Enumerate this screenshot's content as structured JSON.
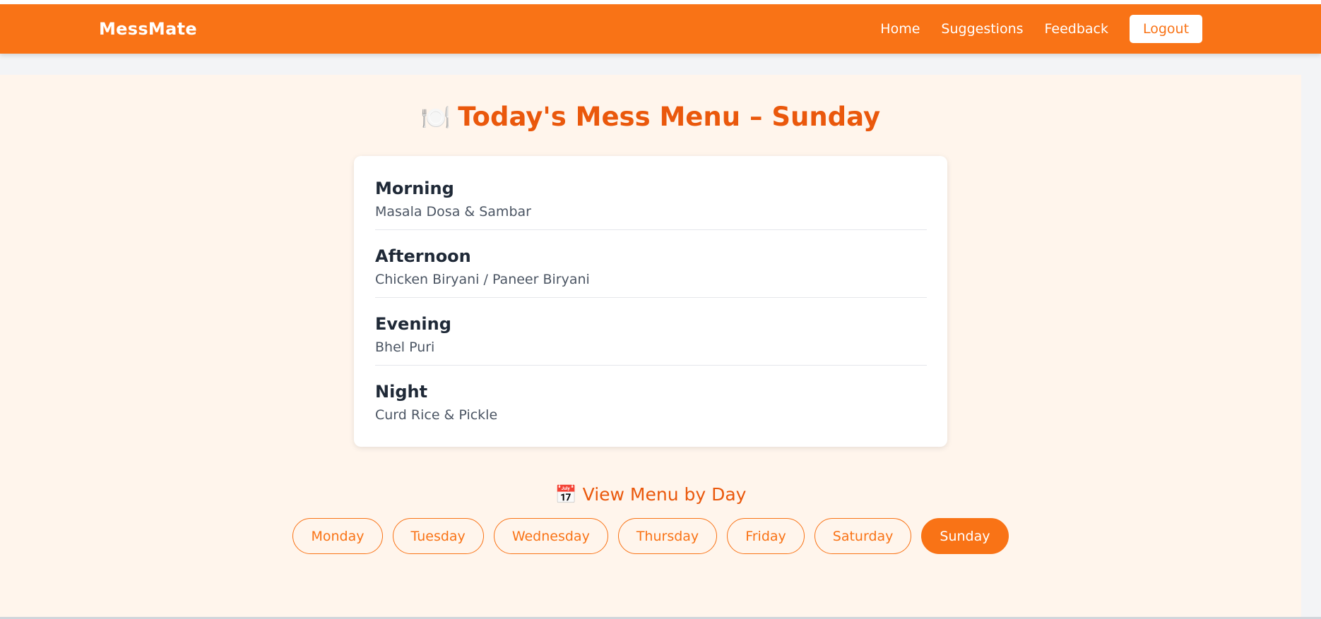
{
  "navbar": {
    "brand": "MessMate",
    "links": [
      {
        "label": "Home"
      },
      {
        "label": "Suggestions"
      },
      {
        "label": "Feedback"
      }
    ],
    "logout_label": "Logout"
  },
  "page": {
    "title_icon": "🍽️",
    "title": "Today's Mess Menu – Sunday"
  },
  "menu": {
    "meals": [
      {
        "name": "Morning",
        "items": "Masala Dosa & Sambar"
      },
      {
        "name": "Afternoon",
        "items": "Chicken Biryani / Paneer Biryani"
      },
      {
        "name": "Evening",
        "items": "Bhel Puri"
      },
      {
        "name": "Night",
        "items": "Curd Rice & Pickle"
      }
    ]
  },
  "day_selector": {
    "heading_icon": "📅",
    "heading": "View Menu by Day",
    "days": [
      "Monday",
      "Tuesday",
      "Wednesday",
      "Thursday",
      "Friday",
      "Saturday",
      "Sunday"
    ],
    "selected": "Sunday"
  },
  "colors": {
    "accent": "#f97316",
    "title": "#ea580c",
    "background": "#fff5ec"
  }
}
